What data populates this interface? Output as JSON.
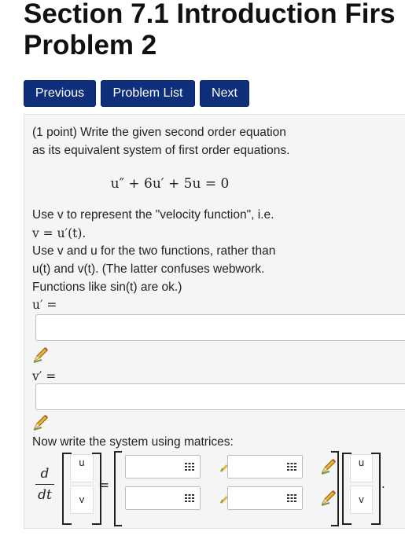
{
  "header": {
    "title_line1": "Section 7.1 Introduction Firs",
    "title_line2": "Problem 2"
  },
  "nav": {
    "previous": "Previous",
    "problem_list": "Problem List",
    "next": "Next"
  },
  "problem": {
    "intro_line1": "(1 point) Write the given second order equation",
    "intro_line2": "as its equivalent system of first order equations.",
    "equation": "u″ + 6u′ + 5u = 0",
    "use_v_line": "Use v to represent the \"velocity function\", i.e.",
    "v_def": "v = u′(t).",
    "use_line1": "Use v and u for the two functions, rather than",
    "use_line2": "u(t) and v(t). (The latter confuses webwork.",
    "use_line3": "Functions like sin(t) are ok.)",
    "uprime_label": "u′ =",
    "vprime_label": "v′ =",
    "uprime_value": "",
    "vprime_value": "",
    "matrix_intro": "Now write the system using matrices:",
    "d_label": "d",
    "dt_label": "dt",
    "vec_left": [
      "u",
      "v"
    ],
    "vec_right": [
      "u",
      "v"
    ],
    "equals": "=",
    "period": "."
  },
  "colors": {
    "nav_button": "#0f2f7a",
    "panel_bg": "#f5f5f5"
  }
}
